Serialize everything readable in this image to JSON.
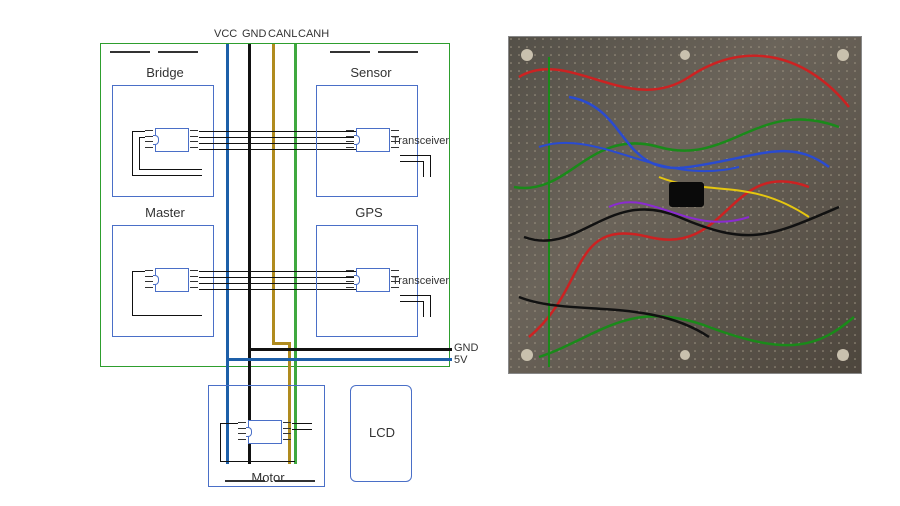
{
  "header": {
    "vcc": "VCC",
    "gnd": "GND",
    "canl": "CANL",
    "canh": "CANH"
  },
  "modules": {
    "bridge": "Bridge",
    "sensor": "Sensor",
    "master": "Master",
    "gps": "GPS",
    "motor": "Motor",
    "lcd": "LCD"
  },
  "labels": {
    "transceiver": "Transceiver",
    "gnd_rail": "GND",
    "five_v_rail": "5V"
  },
  "bus_colors": {
    "vcc": "#1d5fa8",
    "gnd": "#111111",
    "canl": "#b08b1e",
    "canh": "#3fa83f",
    "five_v": "#1d5fa8"
  },
  "photo": {
    "description": "Back side of perfboard with soldered jumper wires in red, green, blue, black, yellow, purple connecting CAN bus nodes."
  }
}
